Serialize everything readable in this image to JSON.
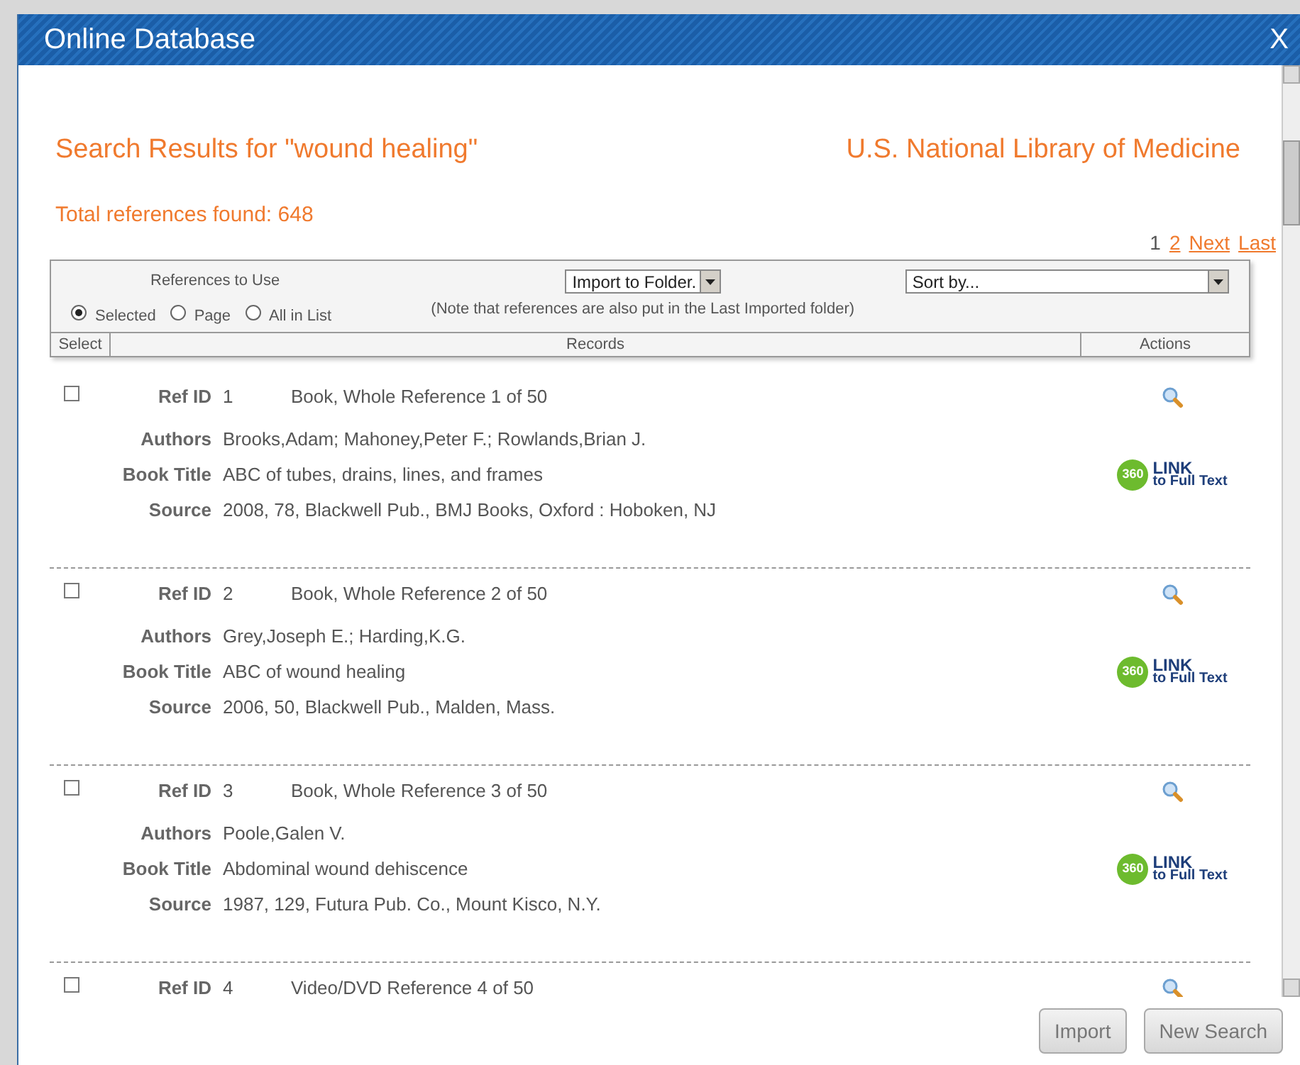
{
  "window": {
    "title": "Online Database",
    "close": "X"
  },
  "heading": {
    "query": "Search Results for \"wound healing\"",
    "source": "U.S. National Library of Medicine",
    "total": "Total references found: 648"
  },
  "pagination": [
    {
      "label": "1",
      "selected": true
    },
    {
      "label": "2",
      "selected": false
    },
    {
      "label": "Next",
      "selected": false
    },
    {
      "label": "Last",
      "selected": false
    }
  ],
  "toolbar": {
    "references_label": "References to Use",
    "options": [
      {
        "label": "Selected",
        "selected": true
      },
      {
        "label": "Page",
        "selected": false
      },
      {
        "label": "All in List",
        "selected": false
      }
    ],
    "folder_select": "Import to Folder.",
    "note": "(Note that references are also put in the Last Imported folder)",
    "sort_select": "Sort by..."
  },
  "table": {
    "columns": [
      "Select",
      "Records",
      "Actions"
    ]
  },
  "records": [
    {
      "checked": false,
      "ref_label": "Ref ID",
      "ref_id": "1",
      "type": "Book, Whole Reference 1 of 50",
      "fields": [
        {
          "label": "Authors",
          "value": "Brooks,Adam; Mahoney,Peter F.; Rowlands,Brian J."
        },
        {
          "label": "Book Title",
          "value": "ABC of tubes, drains, lines, and frames"
        },
        {
          "label": "Source",
          "value": "2008, 78, Blackwell Pub., BMJ Books, Oxford : Hoboken, NJ"
        }
      ],
      "link": {
        "badge": "360",
        "title": "LINK",
        "subtitle": "to Full Text"
      }
    },
    {
      "checked": false,
      "ref_label": "Ref ID",
      "ref_id": "2",
      "type": "Book, Whole Reference 2 of 50",
      "fields": [
        {
          "label": "Authors",
          "value": "Grey,Joseph E.; Harding,K.G."
        },
        {
          "label": "Book Title",
          "value": "ABC of wound healing"
        },
        {
          "label": "Source",
          "value": "2006, 50, Blackwell Pub., Malden, Mass."
        }
      ],
      "link": {
        "badge": "360",
        "title": "LINK",
        "subtitle": "to Full Text"
      }
    },
    {
      "checked": false,
      "ref_label": "Ref ID",
      "ref_id": "3",
      "type": "Book, Whole Reference 3 of 50",
      "fields": [
        {
          "label": "Authors",
          "value": "Poole,Galen V."
        },
        {
          "label": "Book Title",
          "value": "Abdominal wound dehiscence"
        },
        {
          "label": "Source",
          "value": "1987, 129, Futura Pub. Co., Mount Kisco, N.Y."
        }
      ],
      "link": {
        "badge": "360",
        "title": "LINK",
        "subtitle": "to Full Text"
      }
    },
    {
      "checked": false,
      "ref_label": "Ref ID",
      "ref_id": "4",
      "type": "Video/DVD Reference 4 of 50"
    }
  ],
  "buttons": [
    "Import",
    "New Search"
  ]
}
